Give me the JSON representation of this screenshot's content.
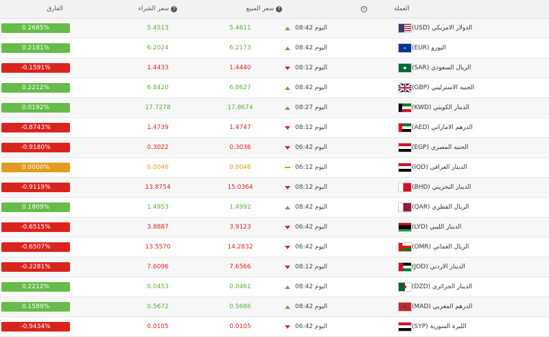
{
  "header": {
    "currency": "العملة",
    "sell": "سعر المبيع",
    "buy": "سعر الشراء",
    "diff": "الفارق",
    "help_glyph": "?",
    "time_icon": "clock-icon"
  },
  "colors": {
    "up": "#66bb4a",
    "down": "#d9241e",
    "flat": "#e39a21"
  },
  "rows": [
    {
      "name": "الدولار الامريكي (USD)",
      "flag": "us",
      "time": "اليوم 08:42",
      "trend": "up",
      "sell": "5.4611",
      "buy": "5.4513",
      "diff": "0.2685%"
    },
    {
      "name": "اليورو (EUR)",
      "flag": "eu",
      "time": "اليوم 08:42",
      "trend": "up",
      "sell": "6.2173",
      "buy": "6.2024",
      "diff": "0.2181%"
    },
    {
      "name": "الريال السعودي (SAR)",
      "flag": "sa",
      "time": "اليوم 08:12",
      "trend": "down",
      "sell": "1.4440",
      "buy": "1.4433",
      "diff": "-0.1591%"
    },
    {
      "name": "الجنيه الاسترليني (GBP)",
      "flag": "gb",
      "time": "اليوم 08:42",
      "trend": "up",
      "sell": "6.8627",
      "buy": "6.8420",
      "diff": "0.2212%"
    },
    {
      "name": "الدينار الكويتي (KWD)",
      "flag": "kw",
      "time": "اليوم 08:27",
      "trend": "up",
      "sell": "17.8674",
      "buy": "17.7278",
      "diff": "0.0192%"
    },
    {
      "name": "الدرهم الاماراتي (AED)",
      "flag": "ae",
      "time": "اليوم 08:12",
      "trend": "down",
      "sell": "1.4747",
      "buy": "1.4739",
      "diff": "-0.8743%"
    },
    {
      "name": "الجنيه المصري (EGP)",
      "flag": "eg",
      "time": "اليوم 06:42",
      "trend": "down",
      "sell": "0.3036",
      "buy": "0.3022",
      "diff": "-0.9180%"
    },
    {
      "name": "الدينار العراقي (IQD)",
      "flag": "iq",
      "time": "اليوم 06:12",
      "trend": "flat",
      "sell": "0.0046",
      "buy": "0.0046",
      "diff": "0.0000%"
    },
    {
      "name": "الدينار البحريني (BHD)",
      "flag": "bh",
      "time": "اليوم 08:12",
      "trend": "down",
      "sell": "15.0364",
      "buy": "13.8754",
      "diff": "-0.9119%"
    },
    {
      "name": "الريال القطري (QAR)",
      "flag": "qa",
      "time": "اليوم 08:42",
      "trend": "up",
      "sell": "1.4992",
      "buy": "1.4953",
      "diff": "0.1809%"
    },
    {
      "name": "الدينار الليبي (LYD)",
      "flag": "ly",
      "time": "اليوم 06:42",
      "trend": "down",
      "sell": "3.9123",
      "buy": "3.8887",
      "diff": "-0.6515%"
    },
    {
      "name": "الريال العماني (OMR)",
      "flag": "om",
      "time": "اليوم 06:42",
      "trend": "down",
      "sell": "14.2832",
      "buy": "13.5570",
      "diff": "-0.6507%"
    },
    {
      "name": "الدينار الاردني (JOD)",
      "flag": "jo",
      "time": "اليوم 08:12",
      "trend": "down",
      "sell": "7.6566",
      "buy": "7.6096",
      "diff": "-0.2281%"
    },
    {
      "name": "الدينار الجزائري (DZD)",
      "flag": "dz",
      "time": "اليوم 08:42",
      "trend": "up",
      "sell": "0.0461",
      "buy": "0.0453",
      "diff": "0.2212%"
    },
    {
      "name": "الدرهم المغربي (MAD)",
      "flag": "ma",
      "time": "اليوم 08:42",
      "trend": "up",
      "sell": "0.5686",
      "buy": "0.5672",
      "diff": "0.1589%"
    },
    {
      "name": "الليرة السورية (SYP)",
      "flag": "sy",
      "time": "اليوم 06:42",
      "trend": "down",
      "sell": "0.0105",
      "buy": "0.0105",
      "diff": "-0.9434%"
    }
  ]
}
